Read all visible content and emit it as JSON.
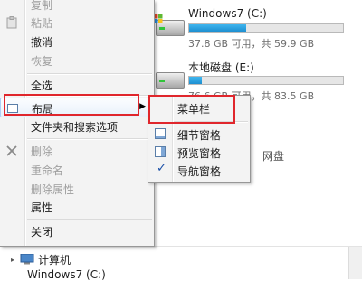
{
  "drives": [
    {
      "name": "Windows7 (C:)",
      "size_text": "37.8 GB 可用，共 59.9 GB",
      "used_fraction": 0.37
    },
    {
      "name": "本地磁盘 (E:)",
      "size_text": "76.6 GB 可用，共 83.5 GB",
      "used_fraction": 0.08
    }
  ],
  "background_text": "网盘",
  "context_menu": {
    "items": [
      {
        "label": "复制",
        "icon": "copy-icon",
        "disabled": true
      },
      {
        "label": "粘贴",
        "icon": "paste-icon",
        "disabled": true
      },
      {
        "label": "撤消",
        "disabled": false
      },
      {
        "label": "恢复",
        "disabled": true
      },
      {
        "label": "全选",
        "disabled": false
      },
      {
        "label": "布局",
        "has_submenu": true,
        "highlighted": true
      },
      {
        "label": "文件夹和搜索选项",
        "disabled": false
      },
      {
        "label": "删除",
        "icon": "delete-x-icon",
        "disabled": true
      },
      {
        "label": "重命名",
        "disabled": true
      },
      {
        "label": "删除属性",
        "disabled": true
      },
      {
        "label": "属性",
        "disabled": false
      },
      {
        "label": "关闭",
        "disabled": false
      }
    ]
  },
  "layout_submenu": {
    "items": [
      {
        "label": "菜单栏",
        "checked": false
      },
      {
        "label": "细节窗格",
        "icon": "details-pane-icon",
        "checked": false
      },
      {
        "label": "预览窗格",
        "icon": "preview-pane-icon",
        "checked": false
      },
      {
        "label": "导航窗格",
        "checked": true
      }
    ]
  },
  "nav_pane": {
    "computer_label": "计算机",
    "child_label": "Windows7 (C:)"
  },
  "colors": {
    "annotation_red": "#e0262c",
    "bar_fill": "#1e8fd0",
    "check_color": "#1a4fa8"
  }
}
